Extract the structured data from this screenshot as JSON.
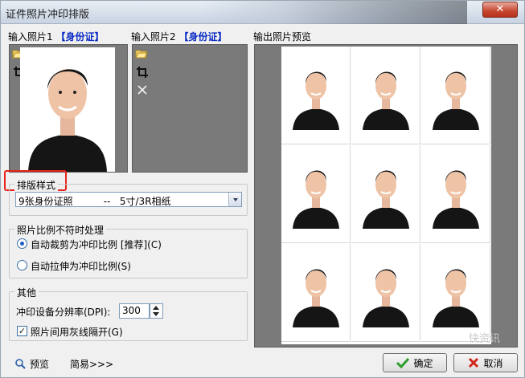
{
  "window": {
    "title": "证件照片冲印排版",
    "close_glyph": "✕"
  },
  "input1": {
    "label": "输入照片1",
    "tag": "【身份证】"
  },
  "input2": {
    "label": "输入照片2",
    "tag": "【身份证】"
  },
  "preview": {
    "label": "输出照片预览",
    "count": 9
  },
  "layout": {
    "group_title": "排版样式",
    "selected": "9张身份证照          --   5寸/3R相纸"
  },
  "ratio": {
    "group_title": "照片比例不符时处理",
    "opt1": "自动裁剪为冲印比例 [推荐](C)",
    "opt2": "自动拉伸为冲印比例(S)"
  },
  "other": {
    "group_title": "其他",
    "dpi_label": "冲印设备分辨率(DPI):",
    "dpi_value": "300",
    "gray_label": "照片间用灰线隔开(G)"
  },
  "footer": {
    "preview_label": "预览",
    "simple_label": "简易>>>",
    "ok_label": "确定",
    "cancel_label": "取消"
  },
  "colors": {
    "accent": "#0b2cc4",
    "highlight": "#e8231b",
    "ok_check": "#2e9e2e",
    "cancel_x": "#d0261c"
  },
  "watermark": "快资讯"
}
